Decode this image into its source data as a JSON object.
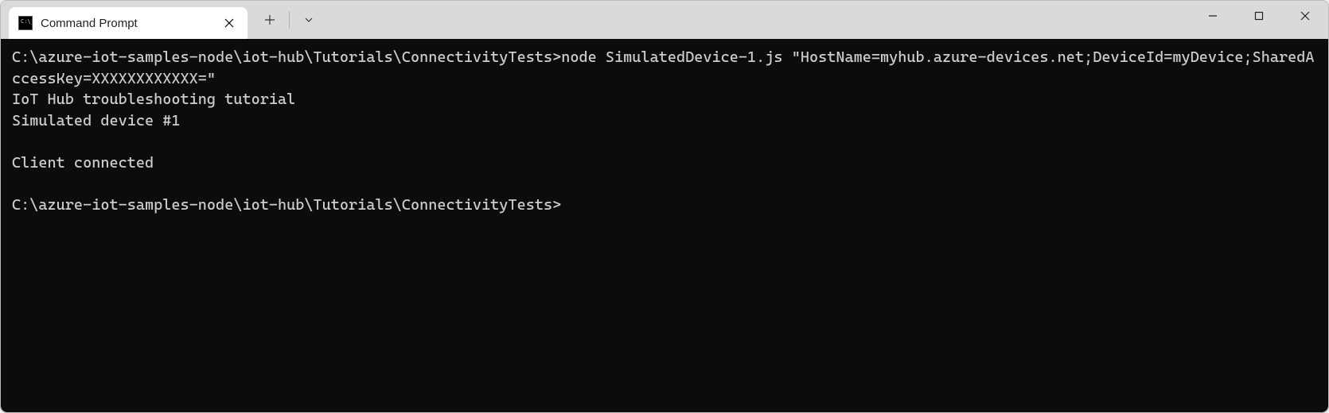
{
  "tab": {
    "title": "Command Prompt"
  },
  "terminal": {
    "line1_prompt": "C:\\azure-iot-samples-node\\iot-hub\\Tutorials\\ConnectivityTests>",
    "line1_cmd": "node SimulatedDevice-1.js \"HostName=myhub.azure-devices.net;DeviceId=myDevice;SharedAccessKey=XXXXXXXXXXXX=\"",
    "line2": "IoT Hub troubleshooting tutorial",
    "line3": "Simulated device #1",
    "line4": "Client connected",
    "line5_prompt": "C:\\azure-iot-samples-node\\iot-hub\\Tutorials\\ConnectivityTests>"
  }
}
